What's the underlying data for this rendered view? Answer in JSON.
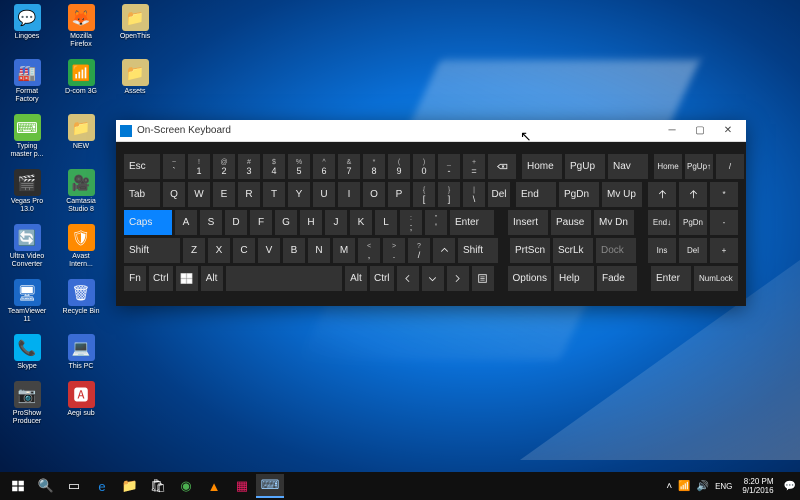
{
  "desktop_icons": [
    [
      {
        "label": "Lingoes",
        "color": "#2aa3e6",
        "glyph": "💬"
      },
      {
        "label": "Mozilla Firefox",
        "color": "#ff7b1a",
        "glyph": "🦊"
      },
      {
        "label": "OpenThis",
        "color": "#d6c27a",
        "glyph": "📁"
      }
    ],
    [
      {
        "label": "Format Factory",
        "color": "#3a6cd4",
        "glyph": "🏭"
      },
      {
        "label": "D-com 3G",
        "color": "#2aa34a",
        "glyph": "📶"
      },
      {
        "label": "Assets",
        "color": "#d6c27a",
        "glyph": "📁"
      }
    ],
    [
      {
        "label": "Typing master p...",
        "color": "#66c040",
        "glyph": "⌨"
      },
      {
        "label": "NEW",
        "color": "#d6c27a",
        "glyph": "📁"
      }
    ],
    [
      {
        "label": "Vegas Pro 13.0",
        "color": "#2e2e2e",
        "glyph": "🎬"
      },
      {
        "label": "Camtasia Studio 8",
        "color": "#3aa757",
        "glyph": "🎥"
      }
    ],
    [
      {
        "label": "Ultra Video Converter",
        "color": "#3a6cd4",
        "glyph": "🔄"
      },
      {
        "label": "Avast Intern...",
        "color": "#ff8a00",
        "glyph": "🛡"
      }
    ],
    [
      {
        "label": "TeamViewer 11",
        "color": "#1b68c6",
        "glyph": "🖥"
      },
      {
        "label": "Recycle Bin",
        "color": "#3a6cd4",
        "glyph": "🗑"
      }
    ],
    [
      {
        "label": "Skype",
        "color": "#00aff0",
        "glyph": "📞"
      },
      {
        "label": "This PC",
        "color": "#3a6cd4",
        "glyph": "💻"
      }
    ],
    [
      {
        "label": "ProShow Producer",
        "color": "#444",
        "glyph": "📷"
      },
      {
        "label": "Aegi sub",
        "color": "#c33",
        "glyph": "🅰"
      }
    ]
  ],
  "osk": {
    "title": "On-Screen Keyboard",
    "rows": {
      "r1": {
        "esc": "Esc",
        "nums": [
          [
            "~",
            "`"
          ],
          [
            "!",
            "1"
          ],
          [
            "@",
            "2"
          ],
          [
            "#",
            "3"
          ],
          [
            "$",
            "4"
          ],
          [
            "%",
            "5"
          ],
          [
            "^",
            "6"
          ],
          [
            "&",
            "7"
          ],
          [
            "*",
            "8"
          ],
          [
            "(",
            "9"
          ],
          [
            ")",
            "0"
          ],
          [
            "_",
            "-"
          ],
          [
            "+",
            "="
          ]
        ],
        "nav": [
          "Home",
          "PgUp",
          "Nav"
        ],
        "np": [
          "Home",
          "PgUp",
          "/"
        ]
      },
      "r2": {
        "tab": "Tab",
        "keys": [
          "Q",
          "W",
          "E",
          "R",
          "T",
          "Y",
          "U",
          "I",
          "O",
          "P"
        ],
        "br": [
          [
            "{",
            "["
          ],
          [
            "}",
            "]"
          ],
          [
            "|",
            "\\"
          ]
        ],
        "del": "Del",
        "nav": [
          "End",
          "PgDn",
          "Mv Up"
        ],
        "np": [
          "",
          "",
          "*"
        ]
      },
      "r3": {
        "caps": "Caps",
        "keys": [
          "A",
          "S",
          "D",
          "F",
          "G",
          "H",
          "J",
          "K",
          "L"
        ],
        "sc": [
          [
            ":",
            ";"
          ],
          [
            "\"",
            "'"
          ]
        ],
        "enter": "Enter",
        "nav": [
          "Insert",
          "Pause",
          "Mv Dn"
        ],
        "np": [
          "End",
          "PgDn",
          "-"
        ]
      },
      "r4": {
        "shift": "Shift",
        "keys": [
          "Z",
          "X",
          "C",
          "V",
          "B",
          "N",
          "M"
        ],
        "punct": [
          [
            "<",
            ","
          ],
          [
            ">",
            "."
          ],
          [
            "?",
            "/"
          ]
        ],
        "shift2": "Shift",
        "nav": [
          "PrtScn",
          "ScrLk",
          "Dock"
        ],
        "np": [
          "Ins",
          "Del",
          "+"
        ]
      },
      "r5": {
        "fn": "Fn",
        "ctrl": "Ctrl",
        "alt": "Alt",
        "alt2": "Alt",
        "ctrl2": "Ctrl",
        "nav": [
          "Options",
          "Help",
          "Fade"
        ],
        "np": [
          "Enter",
          "NumLock"
        ]
      }
    }
  },
  "taskbar": {
    "items": [
      {
        "name": "start",
        "color": "#fff"
      },
      {
        "name": "search",
        "glyph": "🔍"
      },
      {
        "name": "task-view",
        "glyph": "▭"
      },
      {
        "name": "edge",
        "glyph": "e",
        "color": "#1e88e5"
      },
      {
        "name": "explorer",
        "glyph": "📁",
        "color": "#ffcc4d"
      },
      {
        "name": "store",
        "glyph": "🛍",
        "color": "#fff"
      },
      {
        "name": "chrome",
        "glyph": "◉",
        "color": "#4caf50"
      },
      {
        "name": "vlc",
        "glyph": "▲",
        "color": "#ff8a00"
      },
      {
        "name": "app1",
        "glyph": "▦",
        "color": "#e91e63"
      },
      {
        "name": "osk-task",
        "glyph": "⌨",
        "color": "#9ccfff",
        "active": true
      }
    ],
    "tray": {
      "up": "˄",
      "net": "📶",
      "vol": "🔊",
      "lang": "ENG",
      "time": "8:20 PM",
      "date": "9/1/2016",
      "notif": "💬"
    }
  }
}
